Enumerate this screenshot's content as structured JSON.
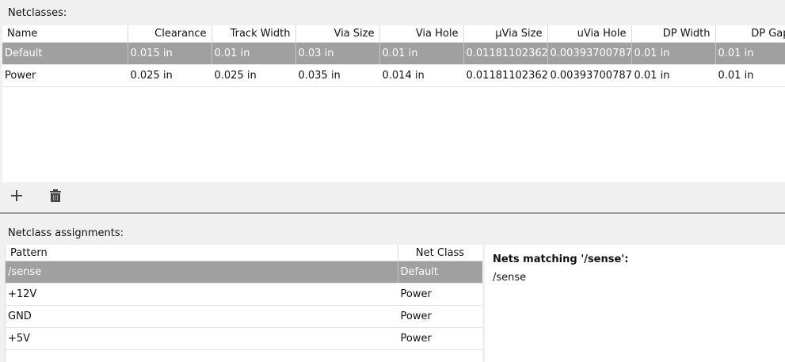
{
  "netclasses": {
    "label": "Netclasses:",
    "columns": [
      "Name",
      "Clearance",
      "Track Width",
      "Via Size",
      "Via Hole",
      "μVia Size",
      "uVia Hole",
      "DP Width",
      "DP Gap"
    ],
    "rows": [
      [
        "Default",
        "0.015 in",
        "0.01 in",
        "0.03 in",
        "0.01 in",
        "0.01181102362",
        "0.00393700787",
        "0.01 in",
        "0.01 in"
      ],
      [
        "Power",
        "0.025 in",
        "0.025 in",
        "0.035 in",
        "0.014 in",
        "0.01181102362",
        "0.00393700787",
        "0.01 in",
        "0.01 in"
      ]
    ],
    "selected_row": 0,
    "add_icon": "plus-icon",
    "delete_icon": "trash-icon"
  },
  "assignments": {
    "label": "Netclass assignments:",
    "columns": [
      "Pattern",
      "Net Class"
    ],
    "rows": [
      [
        "/sense",
        "Default"
      ],
      [
        "+12V",
        "Power"
      ],
      [
        "GND",
        "Power"
      ],
      [
        "+5V",
        "Power"
      ]
    ],
    "selected_row": 0
  },
  "nets_panel": {
    "title": "Nets matching '/sense':",
    "items": [
      "/sense"
    ]
  }
}
